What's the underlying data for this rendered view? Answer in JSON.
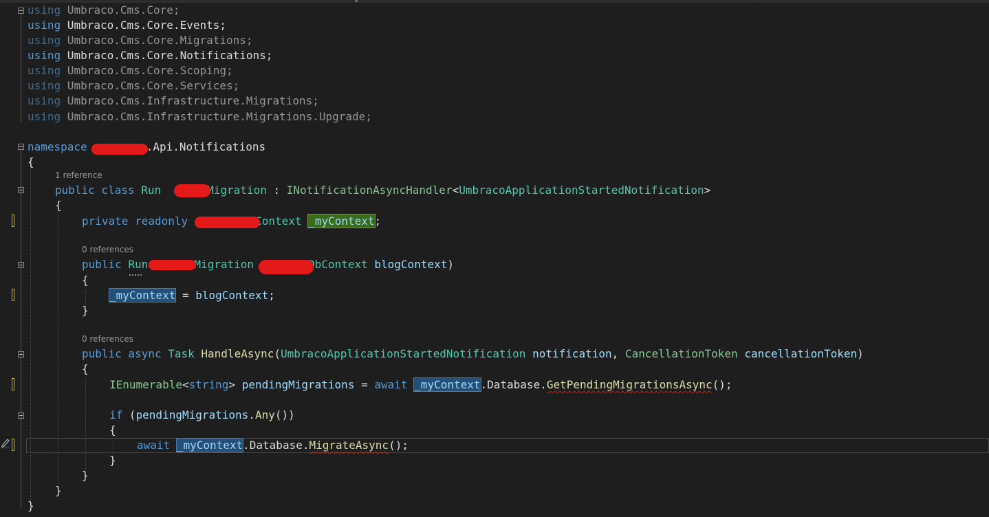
{
  "editor": {
    "usings": [
      "using Umbraco.Cms.Core;",
      "using Umbraco.Cms.Core.Events;",
      "using Umbraco.Cms.Core.Migrations;",
      "using Umbraco.Cms.Core.Notifications;",
      "using Umbraco.Cms.Core.Scoping;",
      "using Umbraco.Cms.Core.Services;",
      "using Umbraco.Cms.Infrastructure.Migrations;",
      "using Umbraco.Cms.Infrastructure.Migrations.Upgrade;"
    ],
    "ns": {
      "keyword": "namespace",
      "name": ".Api.Notifications"
    },
    "open_brace": "{",
    "close_brace": "}",
    "class_hint": "1 reference",
    "class_line": {
      "modifiers": "public class",
      "name_start": "Run",
      "name_end": "Migration",
      "colon": " : ",
      "iface": "INotificationAsyncHandler",
      "lt": "<",
      "type_arg": "UmbracoApplicationStartedNotification",
      "gt": ">"
    },
    "field_line": {
      "modifiers": "private readonly",
      "type_end": "Context",
      "name": "_myContext",
      "semi": ";"
    },
    "ctor_hint": "0 references",
    "ctor_line": {
      "modifier": "public",
      "name_start": "Run",
      "name_end": "Migration",
      "param_type_end": "DbContext",
      "param_name": "blogContext",
      "close": ")"
    },
    "assign_line": {
      "target": "_myContext",
      "op": " = ",
      "value": "blogContext",
      "semi": ";"
    },
    "method_hint": "0 references",
    "method_line": {
      "modifiers": "public async",
      "return_type": "Task",
      "name": "HandleAsync",
      "open": "(",
      "p1_type": "UmbracoApplicationStartedNotification",
      "p1_name": "notification",
      "comma": ", ",
      "p2_type": "CancellationToken",
      "p2_name": "cancellationToken",
      "close": ")"
    },
    "pending_line": {
      "type": "IEnumerable",
      "lt": "<",
      "type_arg": "string",
      "gt": ">",
      "var": "pendingMigrations",
      "eq": " = ",
      "await": "await",
      "ctx": "_myContext",
      "member": ".Database.",
      "call": "GetPendingMigrationsAsync",
      "tail": "();"
    },
    "if_line": {
      "keyword": "if",
      "open": " (",
      "var": "pendingMigrations",
      "dot": ".",
      "call": "Any",
      "tail": "())"
    },
    "migrate_line": {
      "await": "await",
      "ctx": "_myContext",
      "member": ".Database.",
      "call": "MigrateAsync",
      "tail": "();"
    }
  }
}
